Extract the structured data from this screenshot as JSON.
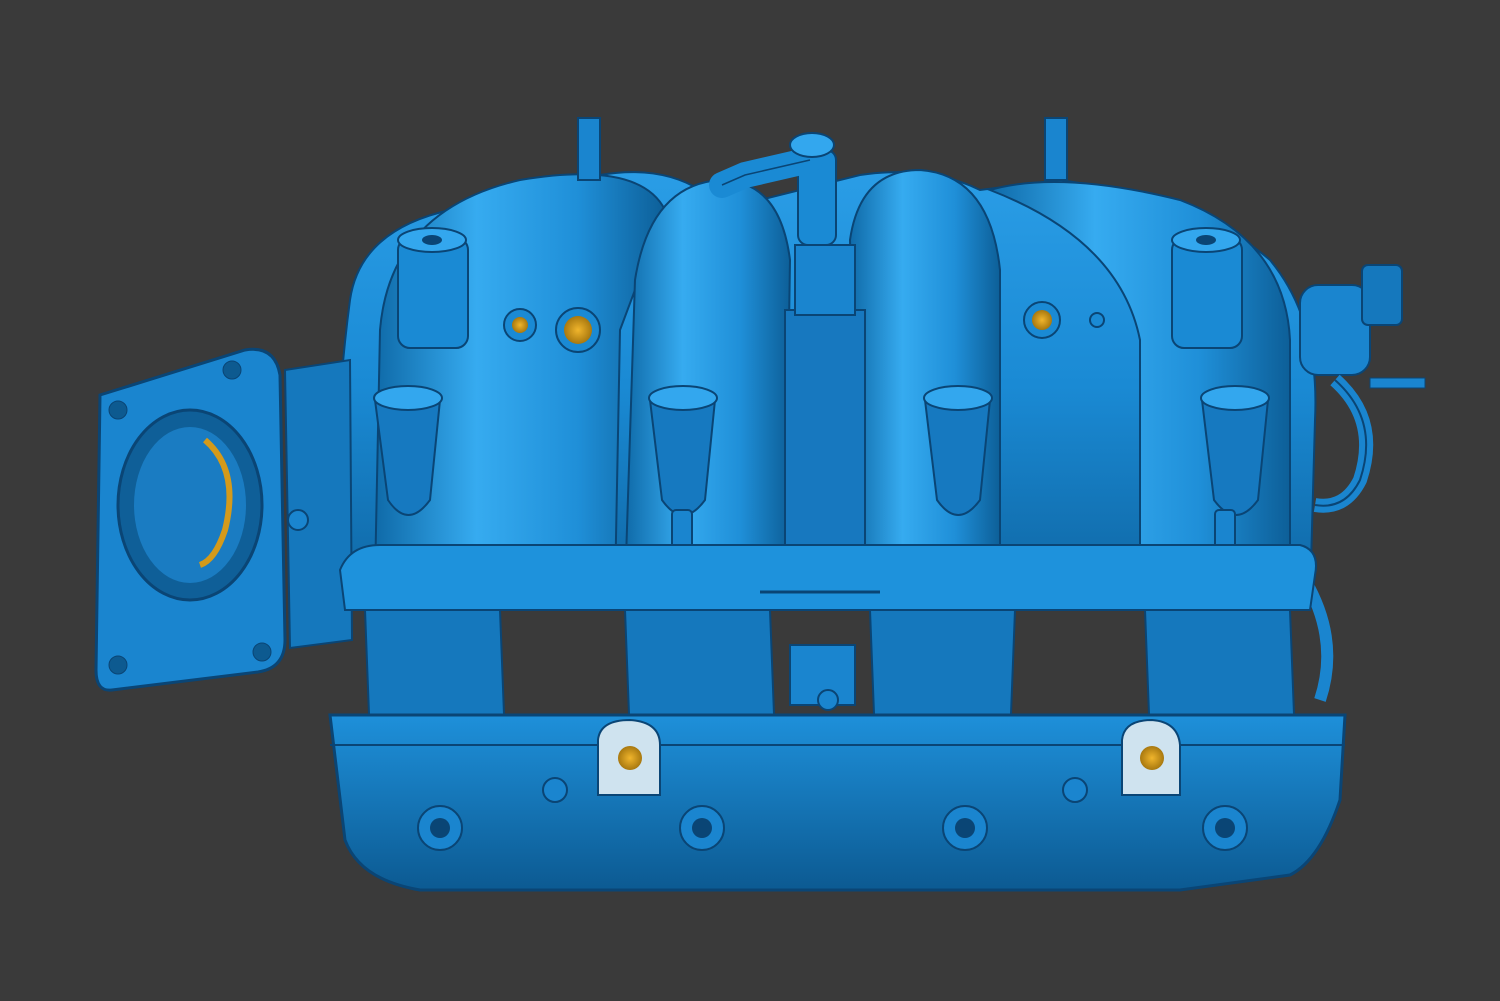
{
  "viewport": {
    "background": "#3a3a3a"
  },
  "model": {
    "subject": "intake-manifold-3d-scan",
    "colors": {
      "surface": "#1a8ad4",
      "surface_light": "#33a7ee",
      "surface_dark": "#0e5f9a",
      "edge": "#0a4575",
      "hole_interior": "#d49a1a",
      "flange_face": "#cfe3ef"
    },
    "runner_count": 4
  }
}
